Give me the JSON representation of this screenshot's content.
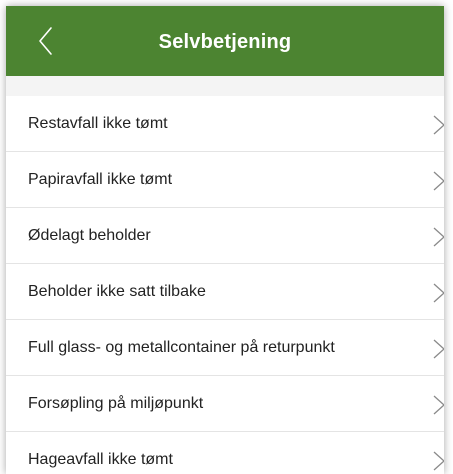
{
  "header": {
    "title": "Selvbetjening",
    "back_icon": "chevron-left-icon",
    "background_color": "#4c8431",
    "text_color": "#ffffff"
  },
  "list": {
    "item_icon": "chevron-right-icon",
    "items": [
      {
        "label": "Restavfall ikke tømt"
      },
      {
        "label": "Papiravfall ikke tømt"
      },
      {
        "label": "Ødelagt beholder"
      },
      {
        "label": "Beholder ikke satt tilbake"
      },
      {
        "label": "Full glass- og metallcontainer på returpunkt"
      },
      {
        "label": "Forsøpling på miljøpunkt"
      },
      {
        "label": "Hageavfall ikke tømt"
      }
    ]
  }
}
